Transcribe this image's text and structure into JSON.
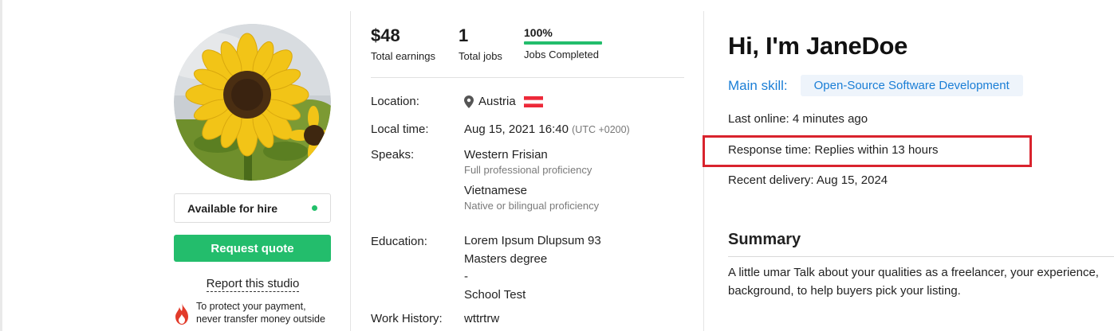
{
  "profile": {
    "availability_label": "Available for hire",
    "request_button": "Request quote",
    "report_link": "Report this studio",
    "protect_note": "To protect your payment, never transfer money outside"
  },
  "stats": {
    "earnings_value": "$48",
    "earnings_label": "Total earnings",
    "jobs_value": "1",
    "jobs_label": "Total jobs",
    "completed_value": "100%",
    "completed_label": "Jobs Completed",
    "completed_fraction": 1.0
  },
  "details": {
    "location_label": "Location:",
    "location_value": "Austria",
    "localtime_label": "Local time:",
    "localtime_value": "Aug 15, 2021 16:40",
    "localtime_tz": "(UTC +0200)",
    "speaks_label": "Speaks:",
    "languages": [
      {
        "name": "Western Frisian",
        "level": "Full professional proficiency"
      },
      {
        "name": "Vietnamese",
        "level": "Native or bilingual proficiency"
      }
    ],
    "education_label": "Education:",
    "education_lines": [
      "Lorem Ipsum Dlupsum 93",
      "Masters degree",
      "-",
      "School Test"
    ],
    "workhistory_label": "Work History:",
    "workhistory_value": "wttrtrw"
  },
  "about": {
    "greeting": "Hi, I'm JaneDoe",
    "main_skill_label": "Main skill:",
    "main_skill_value": "Open-Source Software Development",
    "last_online": "Last online: 4 minutes ago",
    "response_time": "Response time: Replies within 13 hours",
    "recent_delivery": "Recent delivery: Aug 15, 2024",
    "summary_title": "Summary",
    "summary_text": "A little umar Talk about your qualities as a freelancer, your experience, background, to help buyers pick your listing."
  },
  "colors": {
    "accent_green": "#23bd6c",
    "link_blue": "#1a7ed6",
    "highlight_red": "#d9232d"
  }
}
